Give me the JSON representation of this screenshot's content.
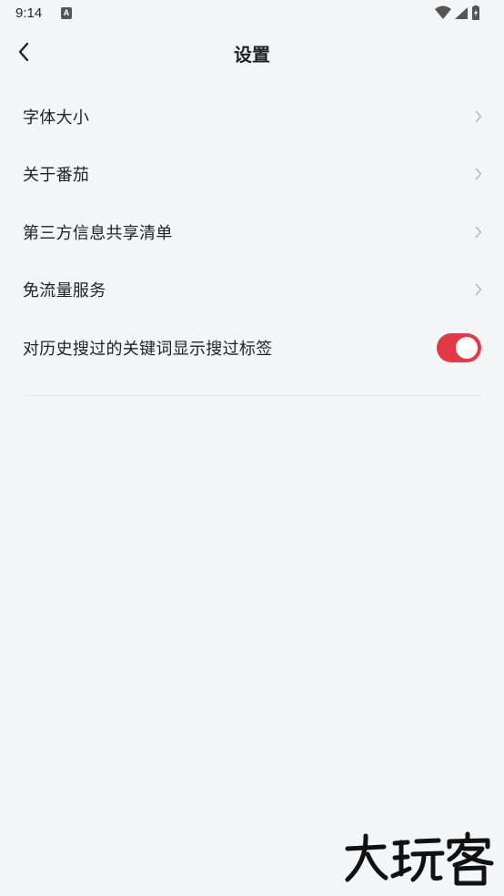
{
  "status_bar": {
    "time": "9:14",
    "notification_icon": "a-letter-icon",
    "icons": [
      "wifi-icon",
      "signal-icon",
      "battery-charging-icon"
    ]
  },
  "header": {
    "title": "设置",
    "back_icon": "back-arrow-icon"
  },
  "settings": [
    {
      "label": "字体大小",
      "control": "chevron-right-icon"
    },
    {
      "label": "关于番茄",
      "control": "chevron-right-icon"
    },
    {
      "label": "第三方信息共享清单",
      "control": "chevron-right-icon"
    },
    {
      "label": "免流量服务",
      "control": "chevron-right-icon"
    },
    {
      "label": "对历史搜过的关键词显示搜过标签",
      "control": "toggle",
      "toggle_on": true
    }
  ],
  "colors": {
    "background": "#f4f5f7",
    "text": "#222222",
    "chevron": "#b5b8be",
    "toggle_accent": "#e23a45"
  },
  "watermark": {
    "text": "大玩客"
  }
}
